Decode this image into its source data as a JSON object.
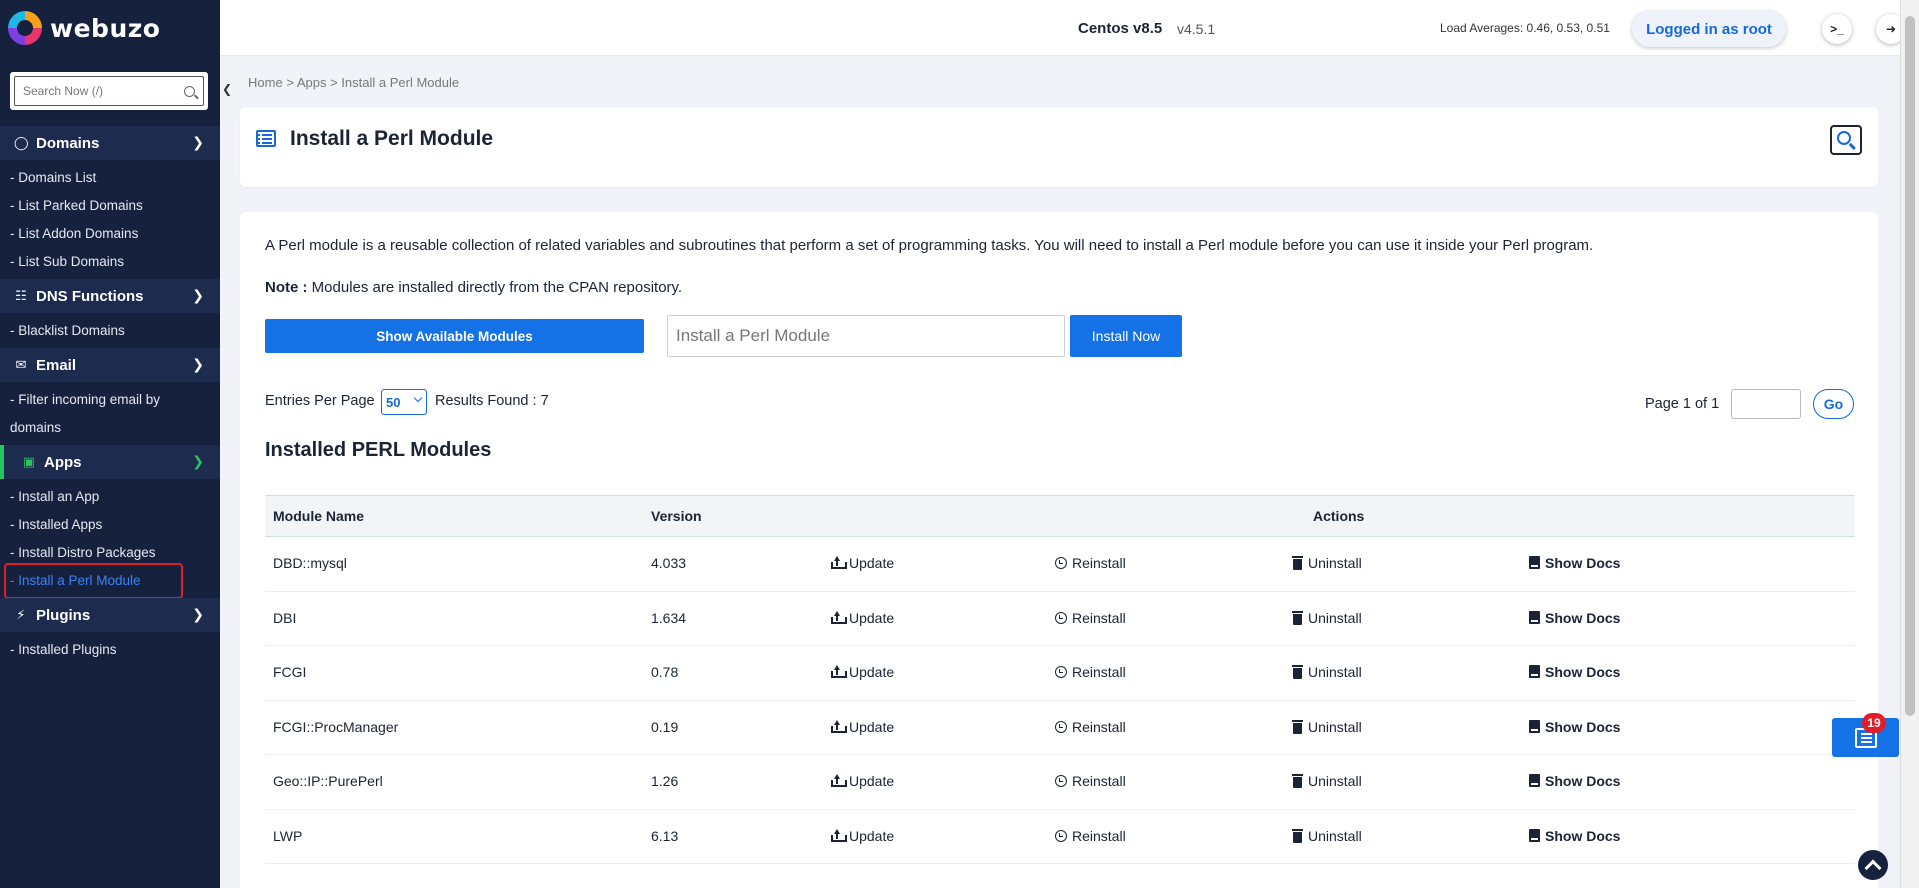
{
  "brand": {
    "name": "webuzo"
  },
  "sidebar": {
    "search_placeholder": "Search Now (/)",
    "sections": [
      {
        "label": "Domains",
        "icon": "globe-icon",
        "items": [
          "- Domains List",
          "- List Parked Domains",
          "- List Addon Domains",
          "- List Sub Domains"
        ]
      },
      {
        "label": "DNS Functions",
        "icon": "sitemap-icon",
        "items": [
          "- Blacklist Domains"
        ]
      },
      {
        "label": "Email",
        "icon": "envelope-icon",
        "items": [
          "- Filter incoming email by",
          "domains"
        ]
      },
      {
        "label": "Apps",
        "icon": "apps-icon",
        "items": [
          "- Install an App",
          "- Installed Apps",
          "- Install Distro Packages",
          "- Install a Perl Module"
        ]
      },
      {
        "label": "Plugins",
        "icon": "plug-icon",
        "items": [
          "- Installed Plugins"
        ]
      }
    ]
  },
  "topbar": {
    "os_name": "Centos v8.5",
    "version": "v4.5.1",
    "load_averages": "Load Averages: 0.46, 0.53, 0.51",
    "login": "Logged in as root"
  },
  "breadcrumb": {
    "home": "Home",
    "apps": "Apps",
    "current": "Install a Perl Module",
    "sep": ">"
  },
  "page": {
    "title": "Install a Perl Module",
    "description": "A Perl module is a reusable collection of related variables and subroutines that perform a set of programming tasks. You will need to install a Perl module before you can use it inside your Perl program.",
    "note_label": "Note :",
    "note_text": " Modules are installed directly from the CPAN repository.",
    "show_modules_label": "Show Available Modules",
    "install_placeholder": "Install a Perl Module",
    "install_button": "Install Now",
    "entries_label": "Entries Per Page",
    "entries_value": "50",
    "results_found": "Results Found : 7",
    "page_of": "Page 1 of 1",
    "go_label": "Go",
    "section_title": "Installed PERL Modules"
  },
  "table": {
    "headers": {
      "name": "Module Name",
      "version": "Version",
      "actions": "Actions"
    },
    "actions": {
      "update": "Update",
      "reinstall": "Reinstall",
      "uninstall": "Uninstall",
      "docs": "Show Docs"
    },
    "rows": [
      {
        "name": "DBD::mysql",
        "version": "4.033"
      },
      {
        "name": "DBI",
        "version": "1.634"
      },
      {
        "name": "FCGI",
        "version": "0.78"
      },
      {
        "name": "FCGI::ProcManager",
        "version": "0.19"
      },
      {
        "name": "Geo::IP::PurePerl",
        "version": "1.26"
      },
      {
        "name": "LWP",
        "version": "6.13"
      }
    ]
  },
  "floating": {
    "news_count": "19"
  },
  "colors": {
    "sidebar_bg": "#16213e",
    "accent_blue": "#1472e6",
    "active_green": "#22c55e",
    "highlight_red": "#e11d2a"
  }
}
